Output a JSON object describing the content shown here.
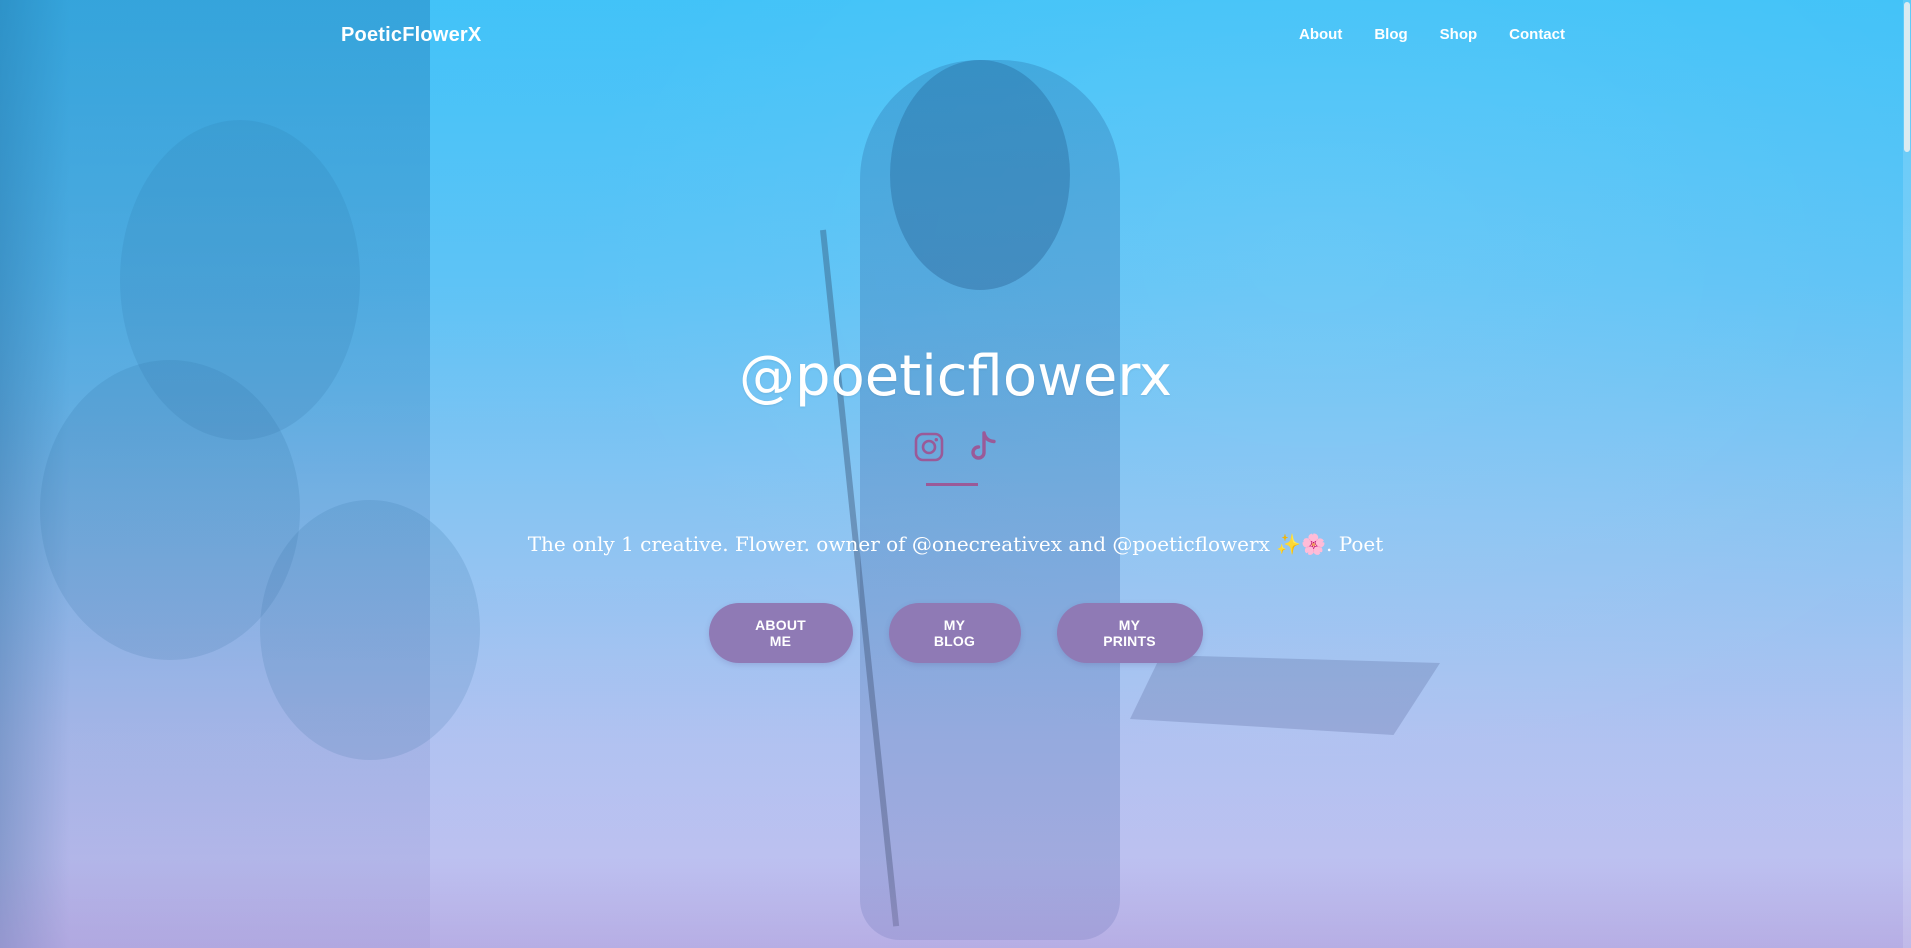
{
  "header": {
    "brand": "PoeticFlowerX",
    "nav": [
      {
        "label": "About"
      },
      {
        "label": "Blog"
      },
      {
        "label": "Shop"
      },
      {
        "label": "Contact"
      }
    ]
  },
  "hero": {
    "title": "@poeticflowerx",
    "socials": [
      {
        "icon": "instagram-icon",
        "color": "#9a5a98"
      },
      {
        "icon": "tiktok-icon",
        "color": "#9a5a98"
      }
    ],
    "tagline": "The only 1 creative. Flower. owner of @onecreativex and @poeticflowerx ✨🌸. Poet",
    "buttons": [
      {
        "label": "ABOUT ME"
      },
      {
        "label": "MY BLOG"
      },
      {
        "label": "MY PRINTS"
      }
    ]
  },
  "colors": {
    "accent": "#9a5a98",
    "button": "#8f7ab5",
    "gradient_top": "#3fc2f7",
    "gradient_bottom": "#c8c0ee"
  }
}
